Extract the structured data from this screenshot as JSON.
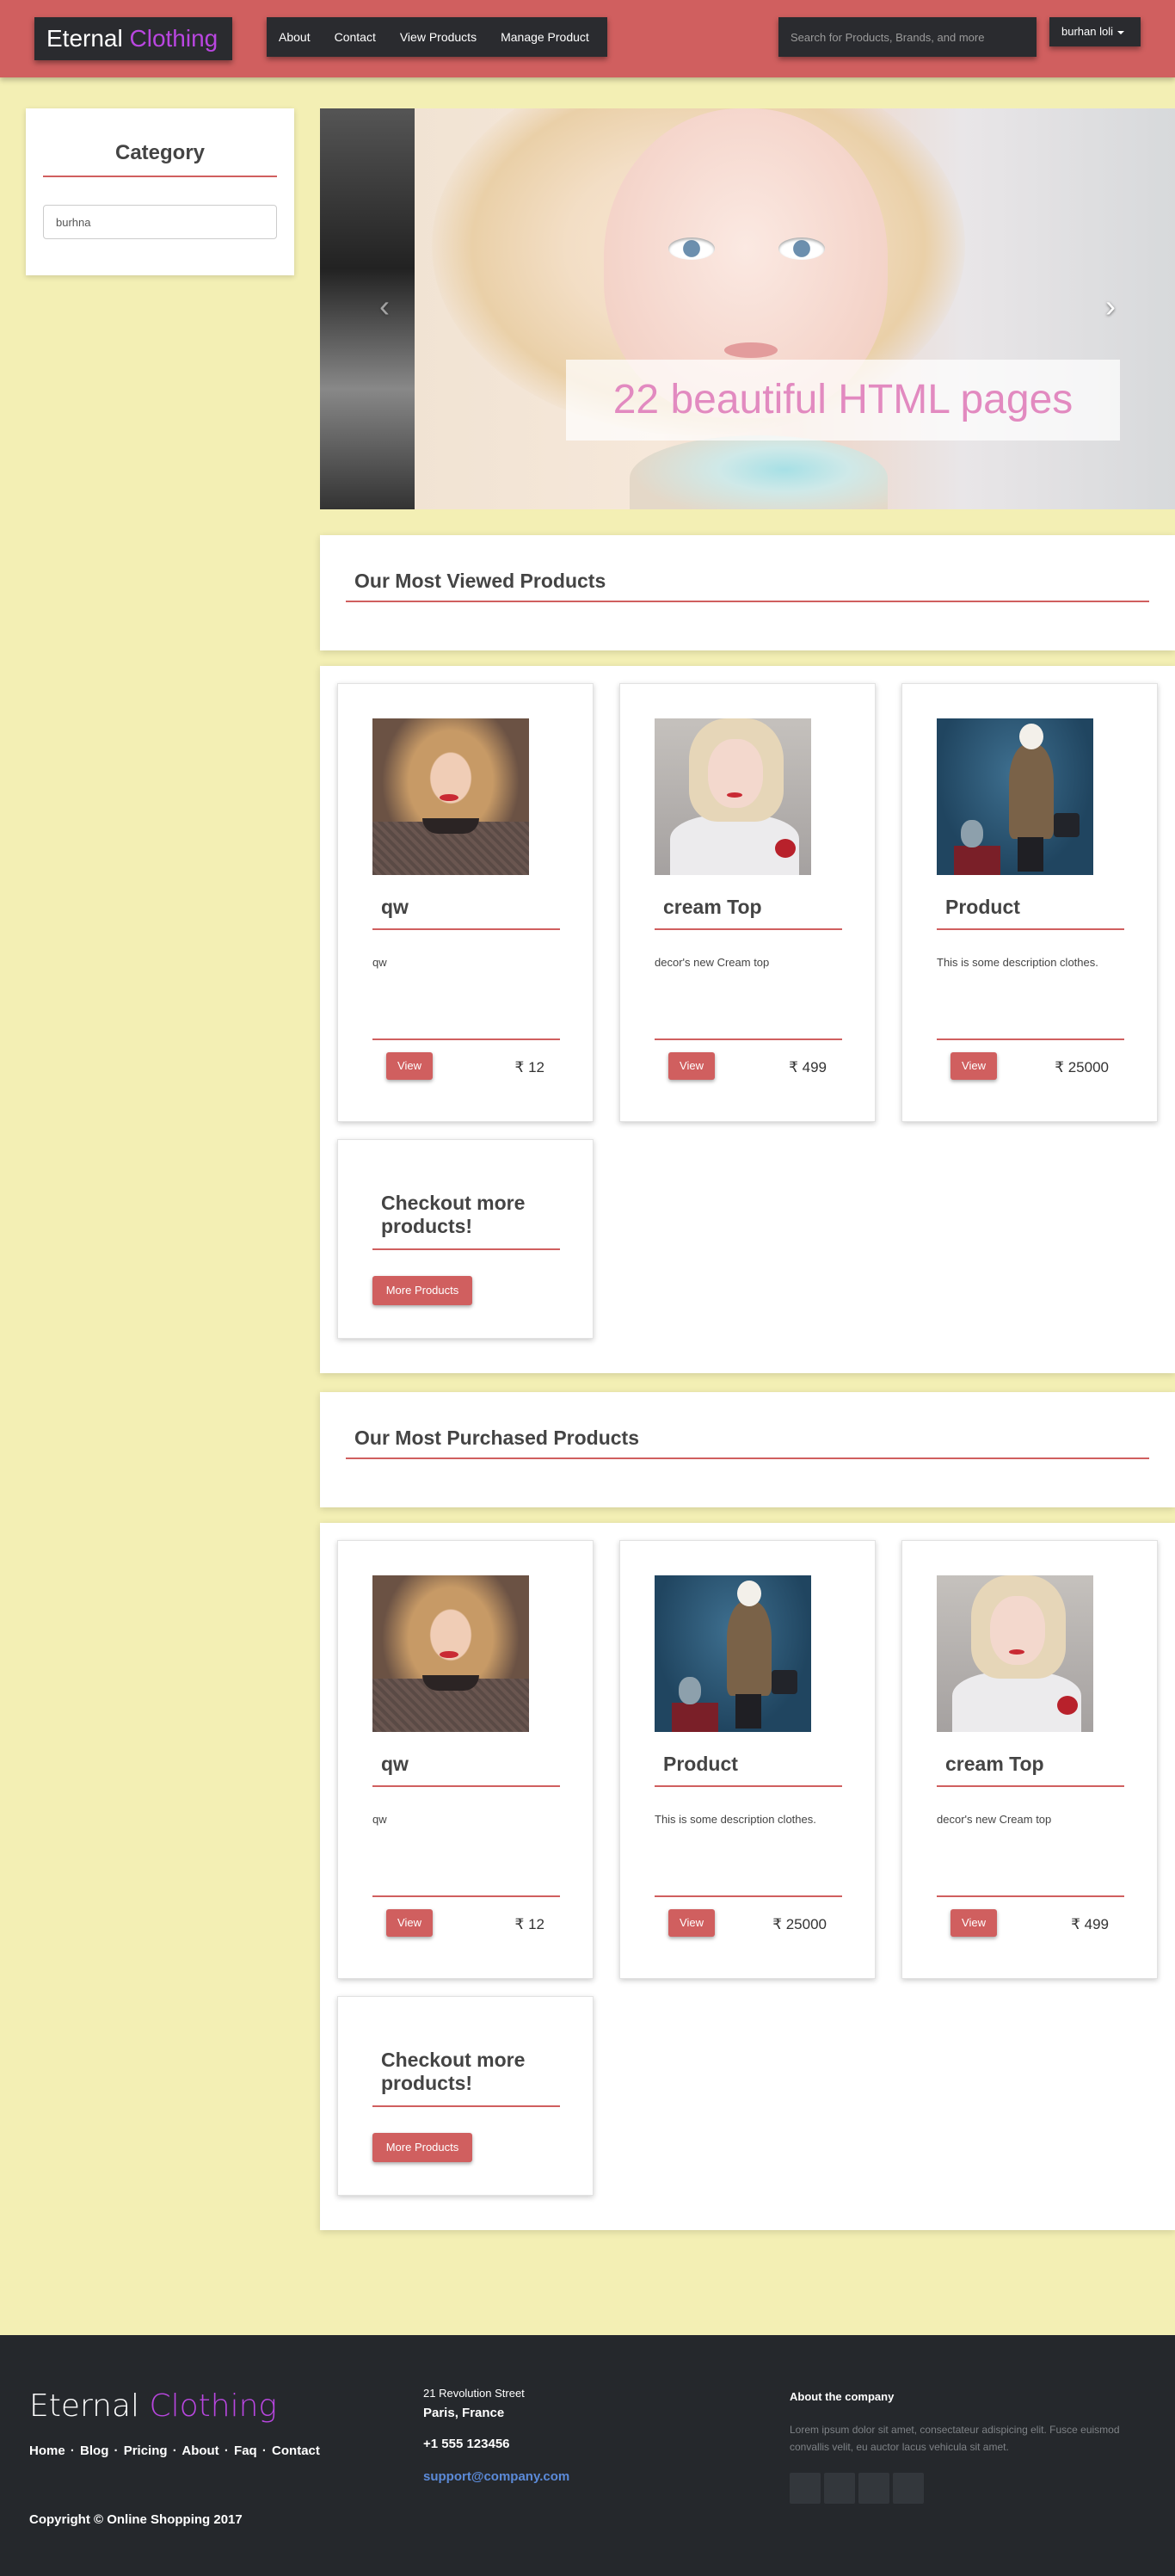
{
  "header": {
    "brand_main": "Eternal",
    "brand_accent": "Clothing",
    "nav": [
      "About",
      "Contact",
      "View Products",
      "Manage Product"
    ],
    "search_placeholder": "Search for Products, Brands, and more",
    "user": "burhan loli"
  },
  "category": {
    "title": "Category",
    "value": "burhna"
  },
  "carousel": {
    "caption": "22 beautiful HTML pages",
    "prev_icon": "chevron-left-icon",
    "next_icon": "chevron-right-icon"
  },
  "most_viewed": {
    "title": "Our Most Viewed Products",
    "products": [
      {
        "name": "qw",
        "desc": "qw",
        "view": "View",
        "price": "₹ 12"
      },
      {
        "name": "cream Top",
        "desc": "decor's new Cream top",
        "view": "View",
        "price": "₹ 499"
      },
      {
        "name": "Product",
        "desc": "This is some description clothes.",
        "view": "View",
        "price": "₹ 25000"
      }
    ],
    "more_title": "Checkout more products!",
    "more_button": "More Products"
  },
  "most_purchased": {
    "title": "Our Most Purchased Products",
    "products": [
      {
        "name": "qw",
        "desc": "qw",
        "view": "View",
        "price": "₹ 12"
      },
      {
        "name": "Product",
        "desc": "This is some description clothes.",
        "view": "View",
        "price": "₹ 25000"
      },
      {
        "name": "cream Top",
        "desc": "decor's new Cream top",
        "view": "View",
        "price": "₹ 499"
      }
    ],
    "more_title": "Checkout more products!",
    "more_button": "More Products"
  },
  "footer": {
    "brand_main": "Eternal",
    "brand_accent": "Clothing",
    "links": [
      "Home",
      "Blog",
      "Pricing",
      "About",
      "Faq",
      "Contact"
    ],
    "link_separator": "·",
    "copyright": "Copyright © Online Shopping 2017",
    "address_line1": "21 Revolution Street",
    "address_line2": "Paris, France",
    "phone": "+1 555 123456",
    "email": "support@company.com",
    "about_title": "About the company",
    "about_text": "Lorem ipsum dolor sit amet, consectateur adispicing elit. Fusce euismod convallis velit, eu auctor lacus vehicula sit amet."
  }
}
